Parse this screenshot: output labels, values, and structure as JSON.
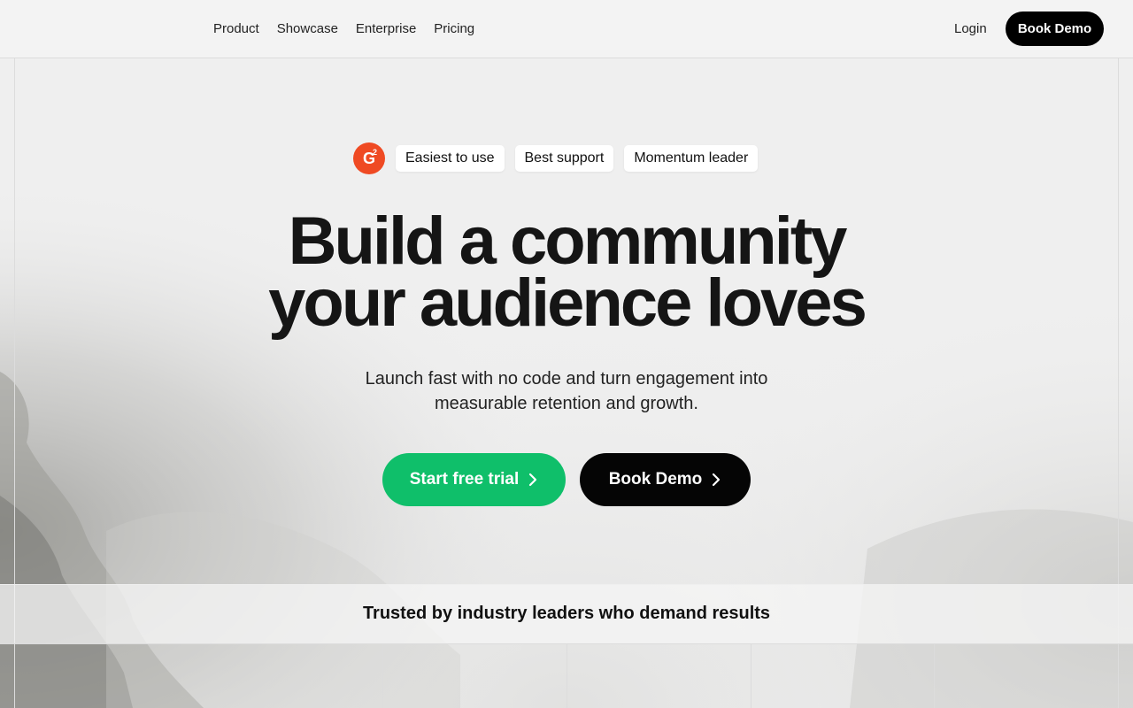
{
  "nav": {
    "links": [
      "Product",
      "Showcase",
      "Enterprise",
      "Pricing"
    ],
    "login": "Login",
    "cta": "Book Demo"
  },
  "badges": {
    "logo_text": "G",
    "logo_sup": "2",
    "items": [
      "Easiest to use",
      "Best support",
      "Momentum leader"
    ]
  },
  "hero": {
    "headline_line1": "Build a community",
    "headline_line2": "your audience loves",
    "sub_line1": "Launch fast with no code and turn engagement into",
    "sub_line2": "measurable retention and growth.",
    "primary_cta": "Start free trial",
    "secondary_cta": "Book Demo"
  },
  "trusted": {
    "heading": "Trusted by industry leaders who demand results"
  },
  "colors": {
    "accent_green": "#0fbf6a",
    "g2_red": "#ef4a23",
    "dark": "#050505"
  }
}
